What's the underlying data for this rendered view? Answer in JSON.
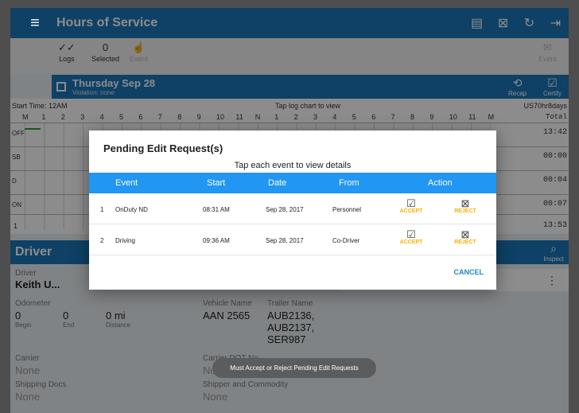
{
  "app": {
    "title": "Hours of Service"
  },
  "toolbar": {
    "logs_label": "Logs",
    "selected_count": "0",
    "selected_label": "Selected",
    "event_label": "Event",
    "event_right_label": "Event"
  },
  "day": {
    "title": "Thursday Sep 28",
    "violation": "Violation: none",
    "recap_label": "Recap",
    "certify_label": "Certify"
  },
  "chart": {
    "start_time": "Start Time: 12AM",
    "tap_hint": "Tap log chart to view",
    "cycle": "US70hr8days",
    "hours": [
      "M",
      "1",
      "2",
      "3",
      "4",
      "5",
      "6",
      "7",
      "8",
      "9",
      "10",
      "11",
      "N",
      "1",
      "2",
      "3",
      "4",
      "5",
      "6",
      "7",
      "8",
      "9",
      "10",
      "11",
      "M"
    ],
    "total_label": "Total",
    "rows": [
      {
        "label": "OFF",
        "total": "13:42"
      },
      {
        "label": "SB",
        "total": "00:00"
      },
      {
        "label": "D",
        "total": "00:04"
      },
      {
        "label": "ON",
        "total": "00:07"
      }
    ],
    "grand_total": "13:53",
    "bottom_start": "1"
  },
  "driver": {
    "header": "Driver",
    "driver_label": "Driver",
    "driver_name": "Keith U...",
    "odometer_label": "Odometer",
    "begin_val": "0",
    "begin_label": "Begin",
    "end_val": "0",
    "end_label": "End",
    "distance_val": "0 mi",
    "distance_label": "Distance",
    "vehicle_label": "Vehicle Name",
    "vehicle_val": "AAN 2565",
    "trailer_label": "Trailer Name",
    "trailer_val": "AUB2136, AUB2137, SER987",
    "carrier_label": "Carrier",
    "carrier_val": "None",
    "carrier_dot_label": "Carrier DOT No",
    "carrier_dot_val": "No",
    "shipping_label": "Shipping Docs",
    "shipping_val": "None",
    "shipper_label": "Shipper and Commodity",
    "shipper_val": "None"
  },
  "inspect_label": "Inspect",
  "dialog": {
    "title": "Pending Edit Request(s)",
    "hint": "Tap each event to view details",
    "columns": {
      "event": "Event",
      "start": "Start",
      "date": "Date",
      "from": "From",
      "action": "Action"
    },
    "rows": [
      {
        "num": "1",
        "event": "OnDuty ND",
        "start": "08:31 AM",
        "date": "Sep 28, 2017",
        "from": "Personnel",
        "accept": "ACCEPT",
        "reject": "REJECT"
      },
      {
        "num": "2",
        "event": "Driving",
        "start": "09:36 AM",
        "date": "Sep 28, 2017",
        "from": "Co-Driver",
        "accept": "ACCEPT",
        "reject": "REJECT"
      }
    ],
    "cancel": "CANCEL"
  },
  "toast": "Must Accept or Reject Pending Edit Requests",
  "colors": {
    "primary": "#1a77b8",
    "table_header": "#2196f3",
    "accent_yellow": "#f5b400"
  },
  "icons": [
    "menu-icon",
    "chat-icon",
    "dismiss-icon",
    "refresh-icon",
    "logout-icon",
    "accept-icon",
    "reject-icon"
  ]
}
